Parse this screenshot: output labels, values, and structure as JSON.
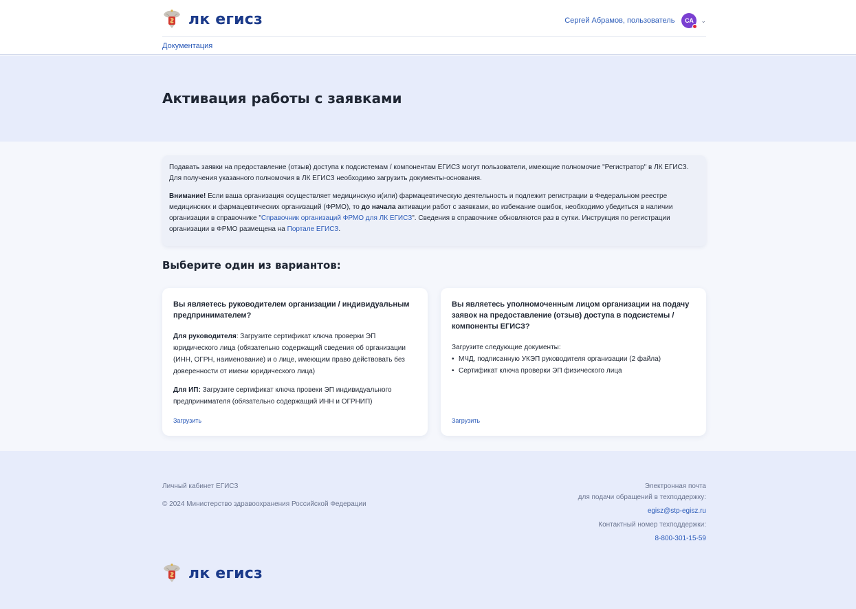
{
  "header": {
    "logo_text": "лк егисз",
    "user_name": "Сергей Абрамов, пользователь",
    "avatar_initials": "СА",
    "nav_documentation": "Документация"
  },
  "hero": {
    "title": "Активация работы с заявками"
  },
  "info": {
    "p1": "Подавать заявки на предоставление (отзыв) доступа к подсистемам / компонентам ЕГИСЗ могут пользователи, имеющие полномочие \"Регистратор\" в ЛК ЕГИСЗ. Для получения указанного полномочия в ЛК ЕГИСЗ необходимо загрузить документы-основания.",
    "warning_label": "Внимание!",
    "p2_a": " Если ваша организация осуществляет медицинскую и(или) фармацевтическую деятельность и подлежит регистрации в Федеральном реестре медицинских и фармацевтических организаций (ФРМО), то ",
    "p2_bold": "до начала",
    "p2_b": " активации работ с заявками, во избежание ошибок, необходимо убедиться в наличии организации в справочнике \"",
    "frmo_link": "Справочник организаций ФРМО для ЛК ЕГИСЗ",
    "p2_c": "\". Сведения в справочнике обновляются раз в сутки. Инструкция по регистрации организации в ФРМО размещена на ",
    "portal_link": "Портале ЕГИСЗ",
    "p2_d": "."
  },
  "choose_title": "Выберите один из вариантов:",
  "card_left": {
    "title": "Вы являетесь руководителем организации / индивидуальным предпринимателем?",
    "head_label": "Для руководителя",
    "head_text": ": Загрузите сертификат ключа проверки ЭП юридического лица (обязательно содержащий сведения об организации (ИНН, ОГРН, наименование) и о лице, имеющим право действовать без доверенности от имени юридического лица)",
    "ip_label": "Для ИП:",
    "ip_text": " Загрузите сертификат ключа провеки ЭП индивидуального предпринимателя (обязательно содержащий ИНН и ОГРНИП)",
    "upload": "Загрузить"
  },
  "card_right": {
    "title": "Вы являетесь уполномоченным лицом организации на подачу заявок на предоставление (отзыв) доступа в подсистемы / компоненты ЕГИСЗ?",
    "intro": "Загрузите следующие документы:",
    "items": [
      "МЧД, подписанную УКЭП руководителя организации (2 файла)",
      "Сертификат ключа проверки ЭП физического лица"
    ],
    "upload": "Загрузить"
  },
  "footer": {
    "cabinet": "Личный кабинет ЕГИСЗ",
    "copyright": "© 2024 Министерство здравоохранения Российской Федерации",
    "email_label_1": "Электронная почта",
    "email_label_2": "для подачи обращений в техподдержку:",
    "email": "egisz@stp-egisz.ru",
    "phone_label": "Контактный номер техподдержки:",
    "phone": "8-800-301-15-59",
    "logo_text": "лк егисз"
  },
  "colors": {
    "brand": "#1b3a8a",
    "link": "#2a5ab8",
    "avatar": "#7a3fd1",
    "hero_bg": "#e7ecfb"
  }
}
